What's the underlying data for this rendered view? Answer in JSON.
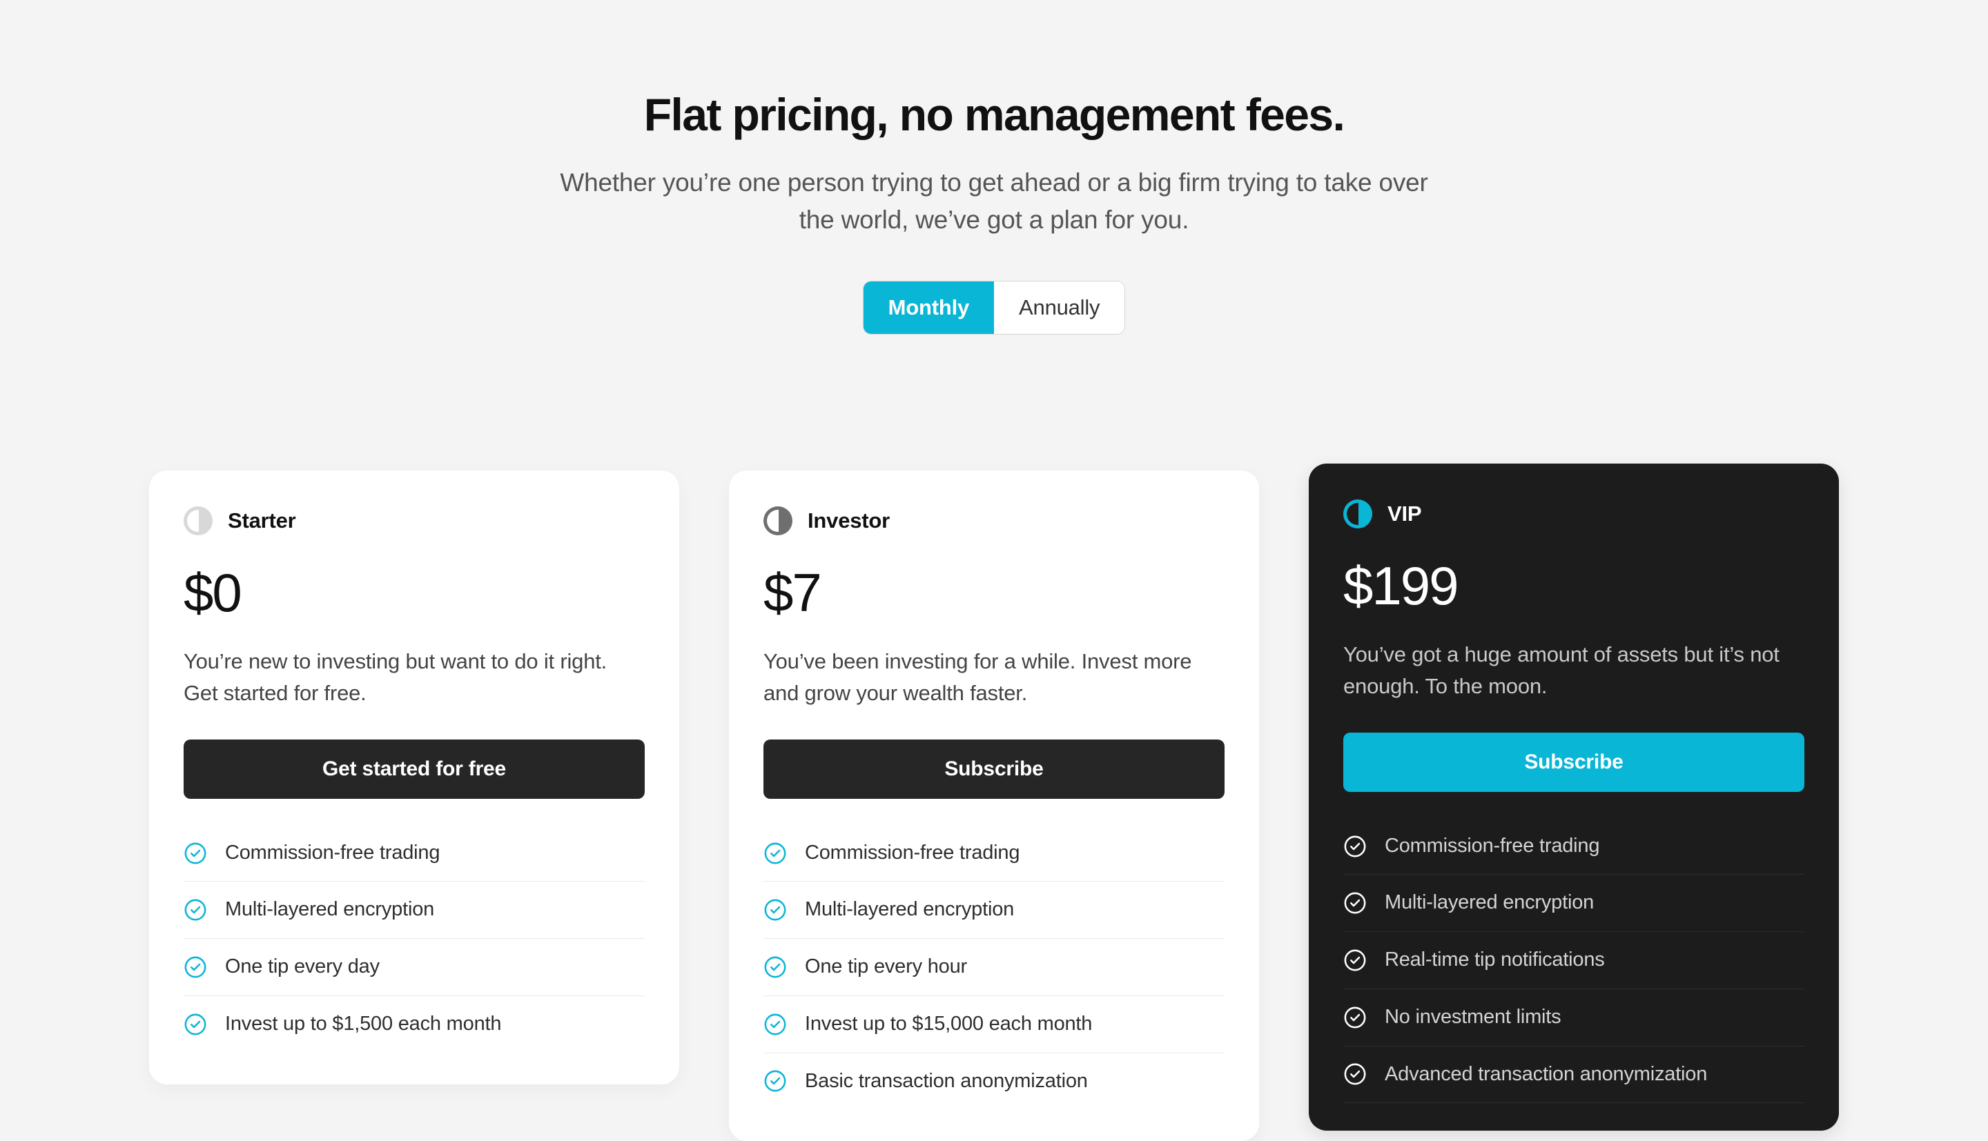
{
  "header": {
    "headline": "Flat pricing, no management fees.",
    "subhead": "Whether you’re one person trying to get ahead or a big firm trying to take over the world, we’ve got a plan for you."
  },
  "billing_toggle": {
    "options": [
      {
        "label": "Monthly",
        "active": true
      },
      {
        "label": "Annually",
        "active": false
      }
    ],
    "selected": "Monthly",
    "active_color": "#0ab6d6"
  },
  "colors": {
    "page_background": "#f4f4f4",
    "accent_cyan": "#0ab6d6",
    "dark_card": "#1c1c1c",
    "dark_button": "#262626"
  },
  "plans": [
    {
      "name": "Starter",
      "logo_icon": "half-moon-icon",
      "price": "$0",
      "description": "You’re new to investing but want to do it right. Get started for free.",
      "cta_label": "Get started for free",
      "cta_style": "dark",
      "theme": "light",
      "features": [
        "Commission-free trading",
        "Multi-layered encryption",
        "One tip every day",
        "Invest up to $1,500 each month"
      ]
    },
    {
      "name": "Investor",
      "logo_icon": "half-moon-icon",
      "price": "$7",
      "description": "You’ve been investing for a while. Invest more and grow your wealth faster.",
      "cta_label": "Subscribe",
      "cta_style": "dark",
      "theme": "light",
      "features": [
        "Commission-free trading",
        "Multi-layered encryption",
        "One tip every hour",
        "Invest up to $15,000 each month",
        "Basic transaction anonymization"
      ]
    },
    {
      "name": "VIP",
      "logo_icon": "half-moon-icon",
      "price": "$199",
      "description": "You’ve got a huge amount of assets but it’s not enough. To the moon.",
      "cta_label": "Subscribe",
      "cta_style": "cyan",
      "theme": "dark",
      "features": [
        "Commission-free trading",
        "Multi-layered encryption",
        "Real-time tip notifications",
        "No investment limits",
        "Advanced transaction anonymization"
      ]
    }
  ]
}
